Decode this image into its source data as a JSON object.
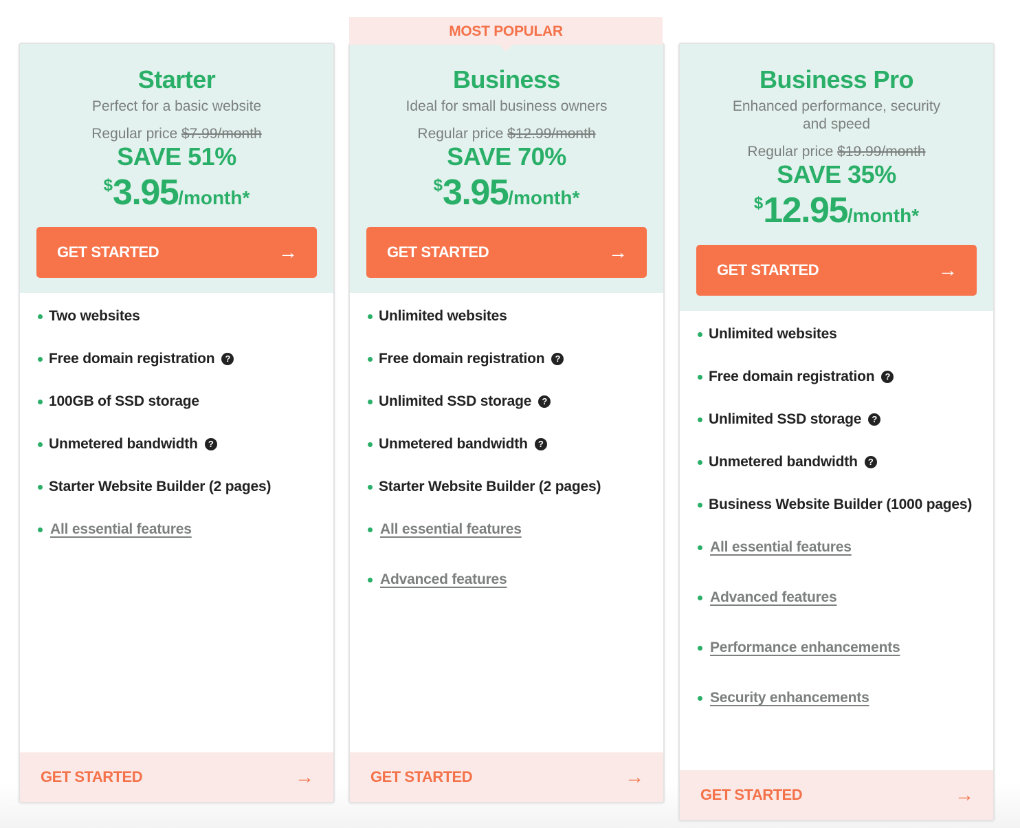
{
  "badge": {
    "label": "MOST POPULAR"
  },
  "colors": {
    "green": "#2aaf68",
    "orange": "#f7744b",
    "mint_bg": "#e3f2ee",
    "pink_bg": "#fbe9e7"
  },
  "plans": [
    {
      "name": "Starter",
      "tagline": "Perfect for a basic website",
      "regular_label": "Regular price",
      "regular_price": "$7.99/month",
      "save": "SAVE 51%",
      "currency": "$",
      "price": "3.95",
      "per": "/month*",
      "cta": "GET STARTED",
      "arrow": "→",
      "features": [
        {
          "text": "Two websites",
          "help": false
        },
        {
          "text": "Free domain registration",
          "help": true
        },
        {
          "text": "100GB of SSD storage",
          "help": false
        },
        {
          "text": "Unmetered bandwidth",
          "help": true
        },
        {
          "text": "Starter Website Builder (2 pages)",
          "help": false
        }
      ],
      "links": [
        "All essential features"
      ],
      "footer_cta": "GET STARTED"
    },
    {
      "name": "Business",
      "tagline": "Ideal for small business owners",
      "regular_label": "Regular price",
      "regular_price": "$12.99/month",
      "save": "SAVE 70%",
      "currency": "$",
      "price": "3.95",
      "per": "/month*",
      "cta": "GET STARTED",
      "arrow": "→",
      "features": [
        {
          "text": "Unlimited websites",
          "help": false
        },
        {
          "text": "Free domain registration",
          "help": true
        },
        {
          "text": "Unlimited SSD storage",
          "help": true
        },
        {
          "text": "Unmetered bandwidth",
          "help": true
        },
        {
          "text": "Starter Website Builder (2 pages)",
          "help": false
        }
      ],
      "links": [
        "All essential features",
        "Advanced features"
      ],
      "footer_cta": "GET STARTED"
    },
    {
      "name": "Business Pro",
      "tagline": "Enhanced performance, security and speed",
      "regular_label": "Regular price",
      "regular_price": "$19.99/month",
      "save": "SAVE 35%",
      "currency": "$",
      "price": "12.95",
      "per": "/month*",
      "cta": "GET STARTED",
      "arrow": "→",
      "features": [
        {
          "text": "Unlimited websites",
          "help": false
        },
        {
          "text": "Free domain registration",
          "help": true
        },
        {
          "text": "Unlimited SSD storage",
          "help": true
        },
        {
          "text": "Unmetered bandwidth",
          "help": true
        },
        {
          "text": "Business Website Builder (1000 pages)",
          "help": false
        }
      ],
      "links": [
        "All essential features",
        "Advanced features",
        "Performance enhancements",
        "Security enhancements"
      ],
      "footer_cta": "GET STARTED"
    }
  ],
  "help_icon_glyph": "?"
}
